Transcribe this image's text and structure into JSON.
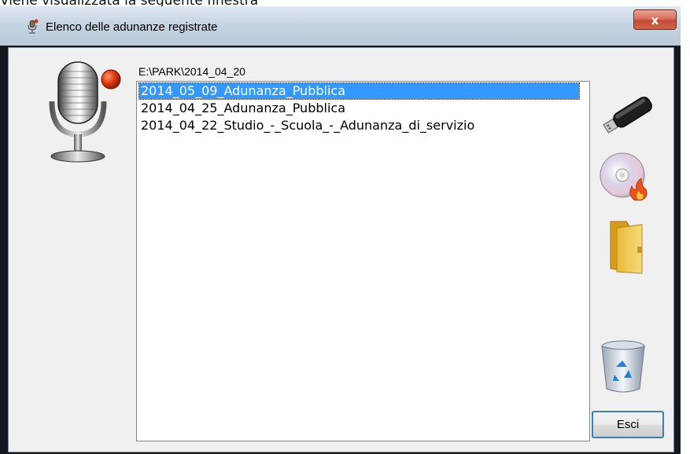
{
  "caption": "Viene visualizzata la seguente finestra",
  "window": {
    "title": "Elenco delle adunanze registrate",
    "close_label": "x"
  },
  "path": "E:\\PARK\\2014_04_20",
  "recordings": [
    {
      "label": "2014_05_09_Adunanza_Pubblica",
      "selected": true
    },
    {
      "label": "2014_04_25_Adunanza_Pubblica",
      "selected": false
    },
    {
      "label": "2014_04_22_Studio_-_Scuola_-_Adunanza_di_servizio",
      "selected": false
    }
  ],
  "side_icons": [
    "usb-drive-icon",
    "burn-disc-icon",
    "folder-icon",
    "recycle-bin-icon"
  ],
  "exit_button": "Esci",
  "colors": {
    "selection": "#3399ff",
    "record_dot": "#d23a1a",
    "titlebar": "#c6d4e2"
  }
}
